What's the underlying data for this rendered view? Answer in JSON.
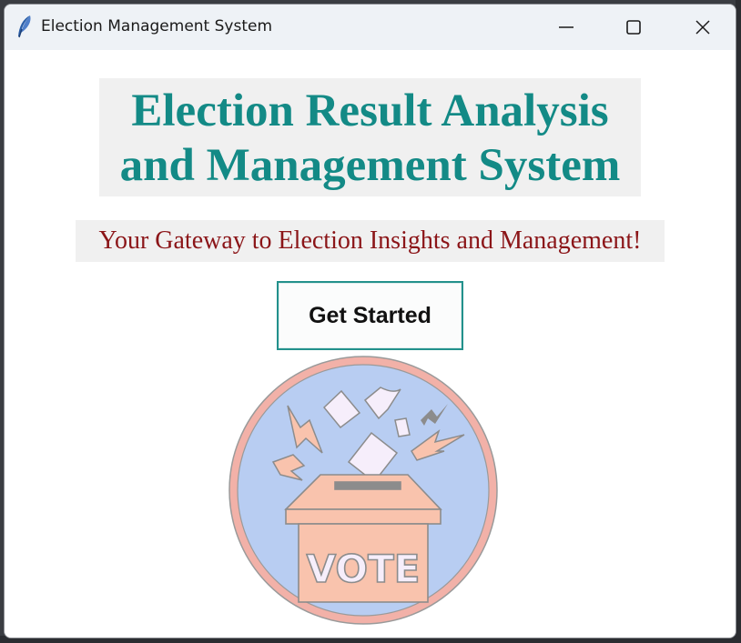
{
  "window": {
    "title": "Election Management System",
    "app_icon": "feather-icon",
    "controls": [
      "minimize-icon",
      "maximize-icon",
      "close-icon"
    ]
  },
  "main": {
    "heading_line1": "Election Result Analysis",
    "heading_line2": "and Management System",
    "subtitle": "Your Gateway to Election Insights and Management!",
    "get_started_label": "Get Started",
    "illustration_text": "VOTE"
  },
  "colors": {
    "heading": "#138a86",
    "subtitle": "#8b1518",
    "button_border": "#23918c",
    "badge_fill": "#b8cdf2",
    "badge_ring": "#f2b1a8",
    "box_fill": "#f9c3ad"
  }
}
